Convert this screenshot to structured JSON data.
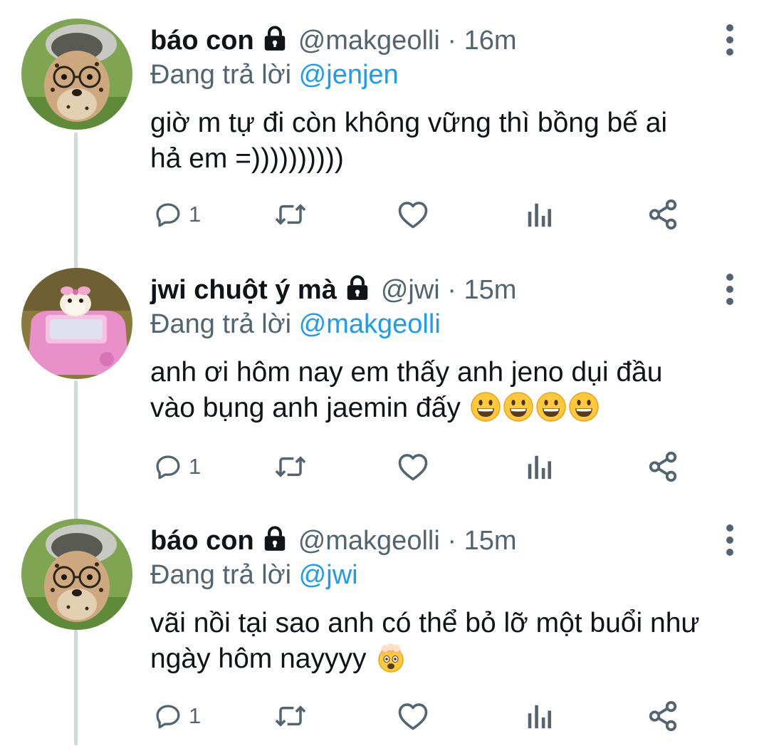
{
  "thread": [
    {
      "display_name": "báo con",
      "handle": "@makgeolli",
      "separator": "·",
      "time": "16m",
      "reply_prefix": "Đang trả lời",
      "reply_mention": "@jenjen",
      "text_lines": [
        "giờ m tự đi còn không vững thì bồng bế ai",
        "hả em =))))))))))"
      ],
      "emoji": [],
      "reply_count": "1",
      "avatar_icon": "cheetah-cub-avatar-icon",
      "protected_icon": "lock-icon"
    },
    {
      "display_name": "jwi chuột ý mà",
      "handle": "@jwi",
      "separator": "·",
      "time": "15m",
      "reply_prefix": "Đang trả lời",
      "reply_mention": "@makgeolli",
      "text_lines": [
        "anh ơi hôm nay em thấy anh jeno dụi đầu",
        "vào bụng anh jaemin đấy"
      ],
      "emoji": [
        "grinning-face-emoji",
        "grinning-face-emoji",
        "grinning-face-emoji",
        "grinning-face-emoji"
      ],
      "reply_count": "1",
      "avatar_icon": "hamster-in-pink-car-avatar-icon",
      "protected_icon": "lock-icon"
    },
    {
      "display_name": "báo con",
      "handle": "@makgeolli",
      "separator": "·",
      "time": "15m",
      "reply_prefix": "Đang trả lời",
      "reply_mention": "@jwi",
      "text_lines": [
        "vãi nồi tại sao anh có thể bỏ lỡ một buổi như",
        "ngày hôm nayyyy"
      ],
      "emoji": [
        "exploding-head-emoji"
      ],
      "reply_count": "1",
      "avatar_icon": "cheetah-cub-avatar-icon",
      "protected_icon": "lock-icon"
    }
  ],
  "action_icons": [
    "reply-icon",
    "retweet-icon",
    "like-icon",
    "analytics-icon",
    "share-icon"
  ],
  "colors": {
    "text": "#0f1419",
    "secondary": "#536471",
    "link": "#1d9bf0",
    "thread_line": "#cfd9de",
    "emoji_yellow": "#ffc83d"
  }
}
